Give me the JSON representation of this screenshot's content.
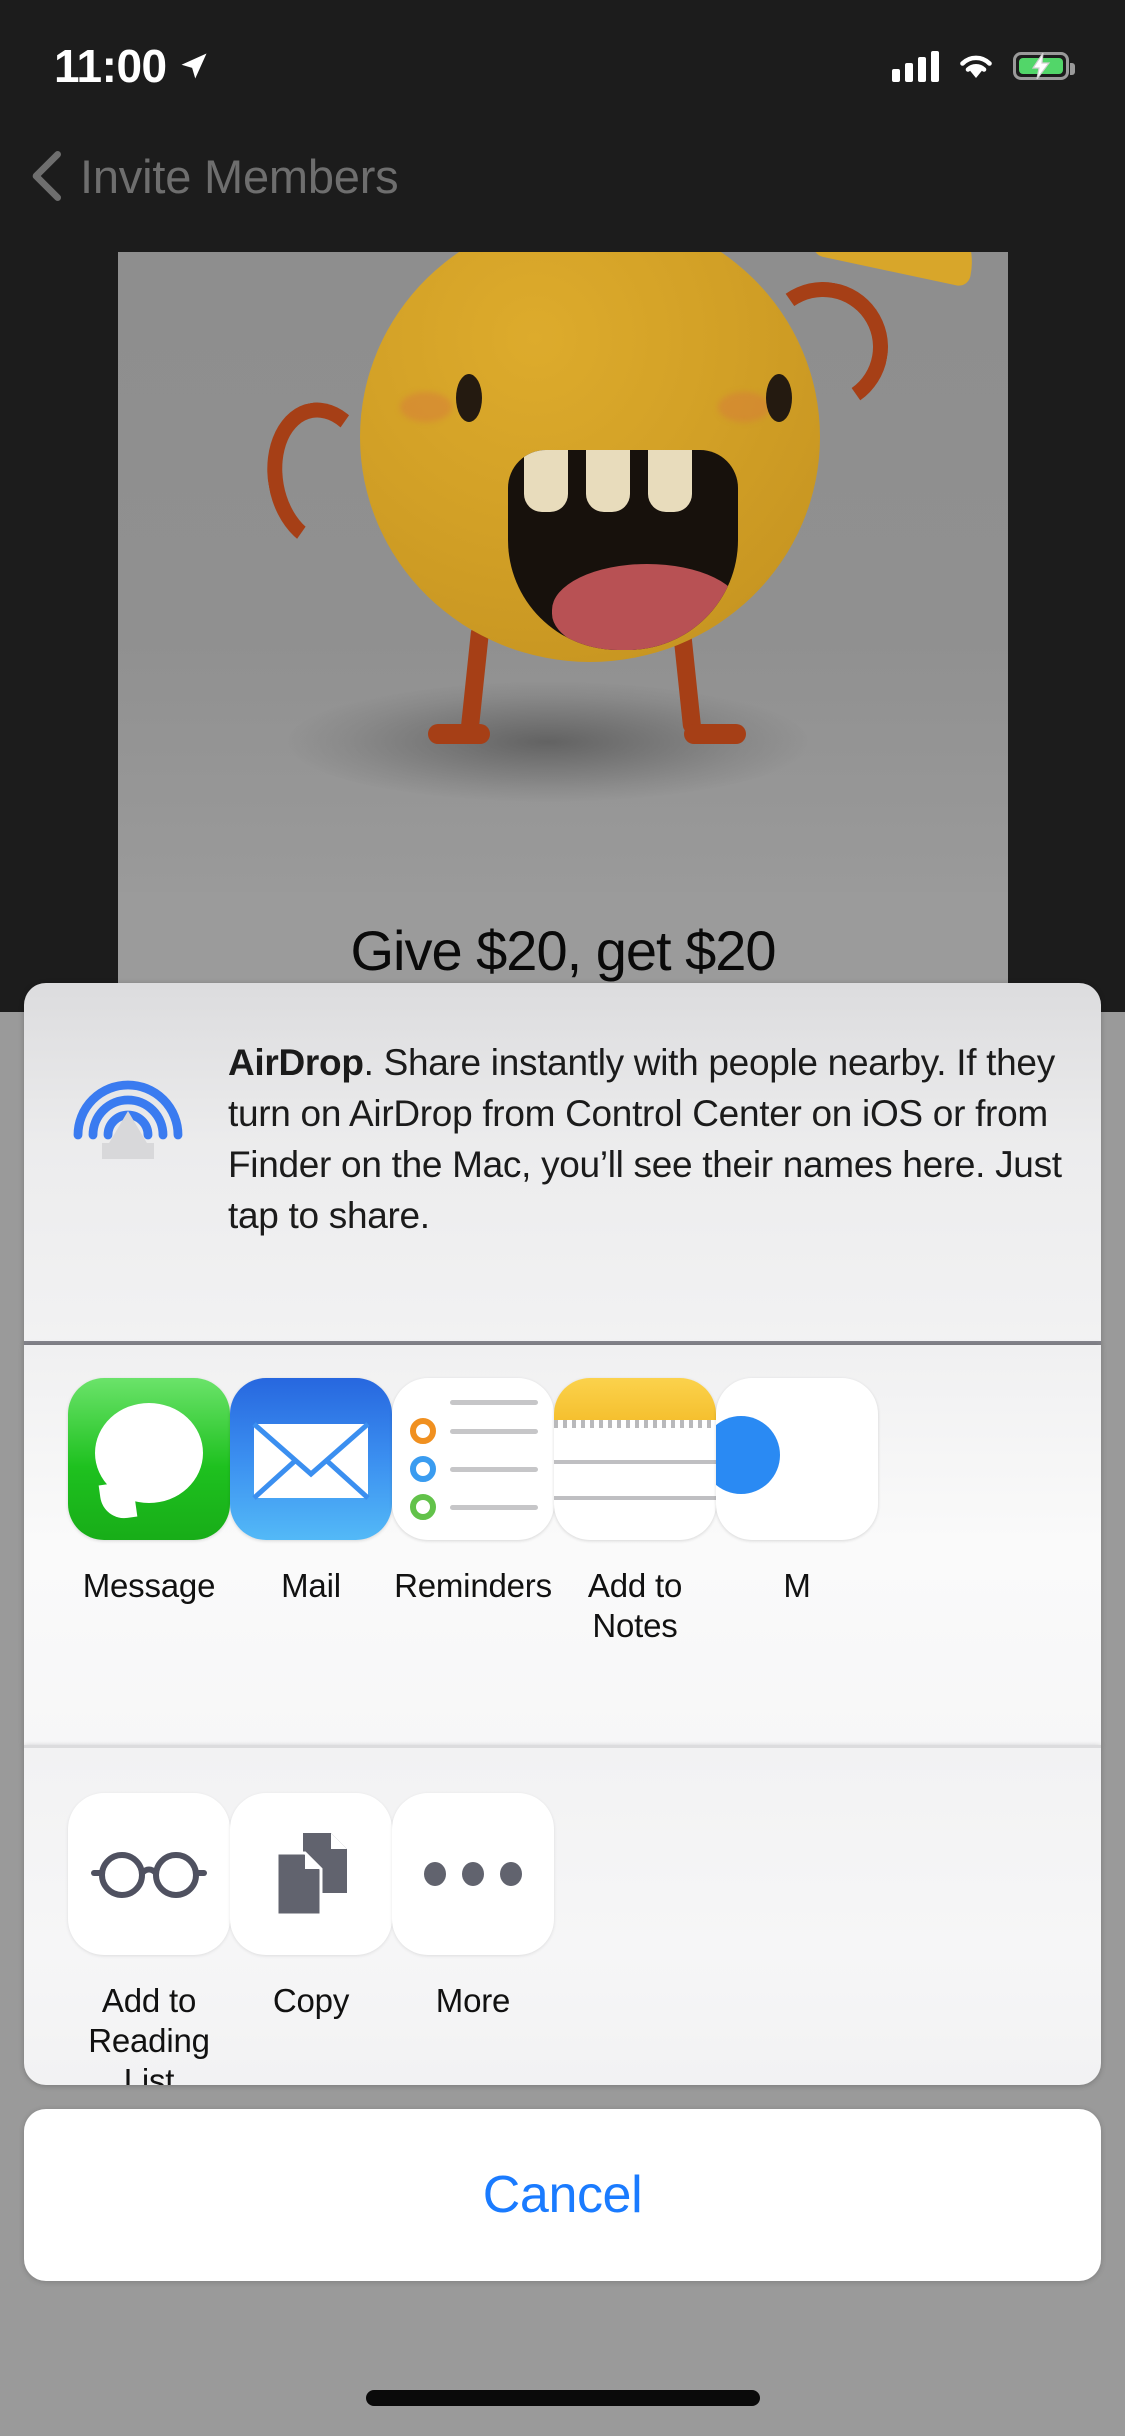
{
  "status_bar": {
    "time": "11:00",
    "location_icon": "location-arrow-icon",
    "signal_icon": "cellular-signal-icon",
    "wifi_icon": "wifi-icon",
    "battery_icon": "battery-charging-icon",
    "battery_color": "#52d669"
  },
  "nav": {
    "back_icon": "chevron-left-icon",
    "title": "Invite Members"
  },
  "background_content": {
    "promo_title": "Give $20, get $20",
    "illustration": "yellow-monster-illustration"
  },
  "share_sheet": {
    "airdrop": {
      "icon": "airdrop-icon",
      "icon_color": "#3a7bf0",
      "title": "AirDrop",
      "body": ". Share instantly with people nearby. If they turn on AirDrop from Control Center on iOS or from Finder on the Mac, you’ll see their names here. Just tap to share."
    },
    "apps": [
      {
        "label": "Message",
        "icon": "messages-app-icon"
      },
      {
        "label": "Mail",
        "icon": "mail-app-icon"
      },
      {
        "label": "Reminders",
        "icon": "reminders-app-icon"
      },
      {
        "label": "Add to Notes",
        "icon": "notes-app-icon"
      },
      {
        "label": "M",
        "icon": "clipped-app-icon"
      }
    ],
    "actions": [
      {
        "label": "Add to\nReading List",
        "label_line1": "Add to",
        "label_line2": "Reading List",
        "icon": "glasses-icon"
      },
      {
        "label": "Copy",
        "label_line1": "Copy",
        "label_line2": "",
        "icon": "copy-documents-icon"
      },
      {
        "label": "More",
        "label_line1": "More",
        "label_line2": "",
        "icon": "ellipsis-icon"
      }
    ],
    "cancel_label": "Cancel",
    "cancel_color": "#1a7bff"
  }
}
